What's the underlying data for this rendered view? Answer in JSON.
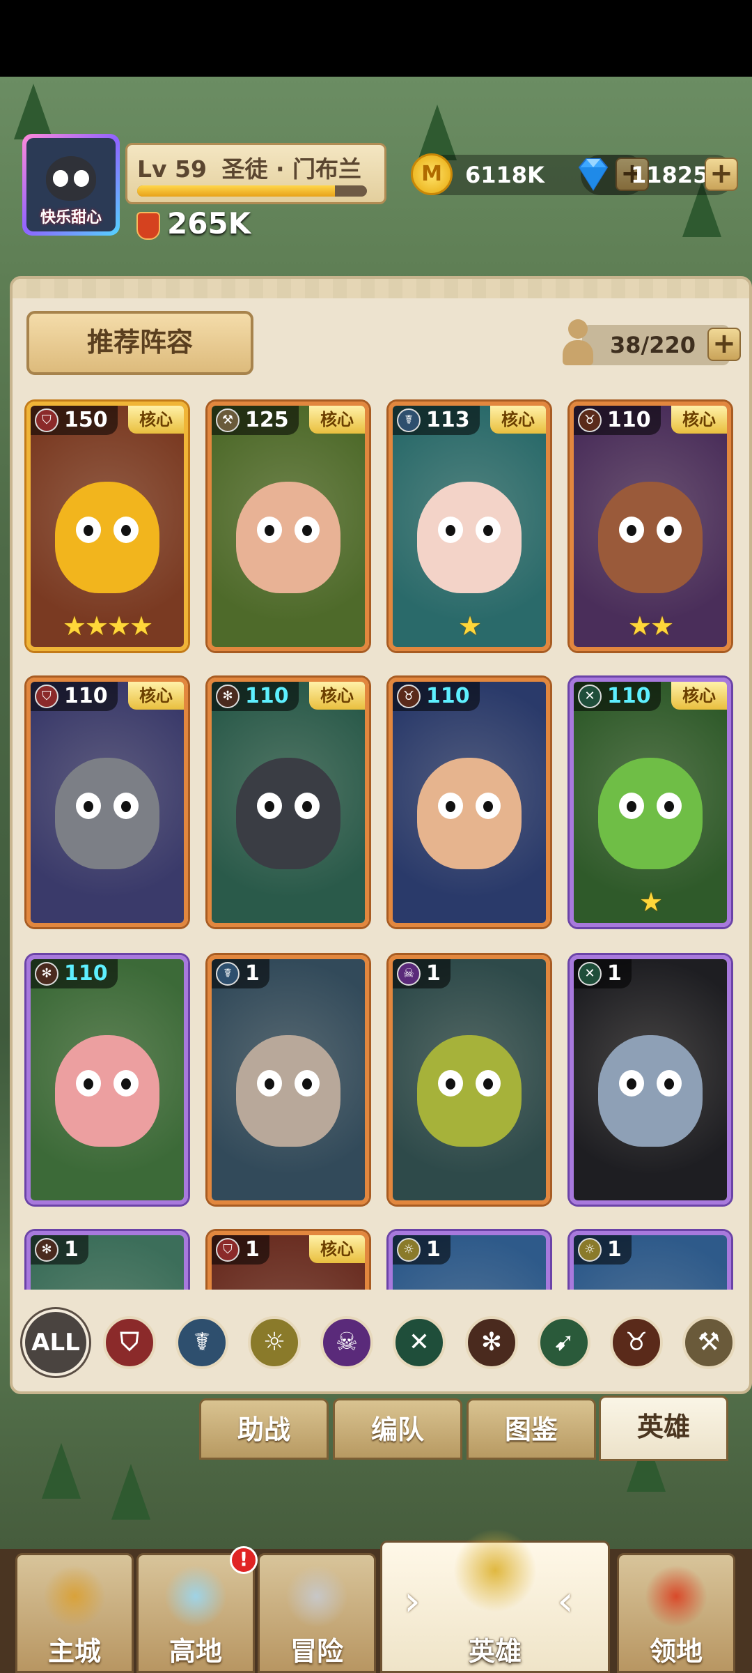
{
  "player": {
    "avatar_name": "快乐甜心",
    "level": "Lv 59",
    "title": "圣徒 · 门布兰",
    "xp_fraction": 0.86,
    "power": "265K"
  },
  "currency": {
    "gold": "6118K",
    "gold_symbol": "M",
    "gems": "11825",
    "add_symbol": "+"
  },
  "panel": {
    "recommend_label": "推荐阵容",
    "capacity": "38/220"
  },
  "heroes": [
    {
      "level": "150",
      "faction": "shield",
      "core": true,
      "stars": "★★★★",
      "rarity": "gold",
      "color": "#f2b51d",
      "bg": "#7a3a22"
    },
    {
      "level": "125",
      "faction": "hammer",
      "core": true,
      "stars": "",
      "rarity": "orange",
      "color": "#e8b295",
      "bg": "#4e6a2a"
    },
    {
      "level": "113",
      "faction": "water",
      "core": true,
      "stars": "★",
      "rarity": "orange",
      "color": "#f3d3c8",
      "bg": "#2a6a6a"
    },
    {
      "level": "110",
      "faction": "bull",
      "core": true,
      "stars": "★★",
      "rarity": "orange",
      "color": "#9a5a3a",
      "bg": "#4a2e5a"
    },
    {
      "level": "110",
      "faction": "shield",
      "core": true,
      "stars": "",
      "rarity": "orange",
      "color": "#7c7f86",
      "bg": "#3a3a6a"
    },
    {
      "level": "110",
      "faction": "paw",
      "core": true,
      "stars": "",
      "rarity": "orange",
      "color": "#3a3d44",
      "bg": "#2a5a4a",
      "teal": true
    },
    {
      "level": "110",
      "faction": "bull",
      "core": false,
      "stars": "",
      "rarity": "orange",
      "color": "#e6b48e",
      "bg": "#2a3a6a",
      "teal": true
    },
    {
      "level": "110",
      "faction": "sword",
      "core": true,
      "stars": "★",
      "rarity": "purple",
      "color": "#6fbe46",
      "bg": "#2f5a2a",
      "teal": true
    },
    {
      "level": "110",
      "faction": "paw",
      "core": false,
      "stars": "",
      "rarity": "purple",
      "color": "#ec9fa0",
      "bg": "#3c6a38",
      "teal": true
    },
    {
      "level": "1",
      "faction": "water",
      "core": false,
      "stars": "",
      "rarity": "orange",
      "color": "#b8a89a",
      "bg": "#324a5a"
    },
    {
      "level": "1",
      "faction": "skull",
      "core": false,
      "stars": "",
      "rarity": "orange",
      "color": "#a6b23a",
      "bg": "#2e4a4a"
    },
    {
      "level": "1",
      "faction": "sword",
      "core": false,
      "stars": "",
      "rarity": "purple",
      "color": "#8ea0b6",
      "bg": "#1e1e22"
    },
    {
      "level": "1",
      "faction": "paw",
      "core": false,
      "stars": "",
      "rarity": "purple",
      "color": "#7fb86a",
      "bg": "#3c6e5a"
    },
    {
      "level": "1",
      "faction": "shield",
      "core": true,
      "stars": "",
      "rarity": "orange",
      "color": "#b27a4a",
      "bg": "#6a2e22"
    },
    {
      "level": "1",
      "faction": "sun",
      "core": false,
      "stars": "",
      "rarity": "purple",
      "color": "#5a8ab0",
      "bg": "#2e5a8a"
    },
    {
      "level": "1",
      "faction": "sun",
      "core": false,
      "stars": "",
      "rarity": "purple",
      "color": "#5a8ab0",
      "bg": "#2e5a8a"
    }
  ],
  "core_label": "核心",
  "filters": [
    {
      "label": "ALL",
      "icon": "all-icon",
      "color": "#4a4440",
      "glyph": "ALL"
    },
    {
      "label": "",
      "icon": "shield-faction-icon",
      "color": "#8b2a2a",
      "glyph": "⛉"
    },
    {
      "label": "",
      "icon": "water-faction-icon",
      "color": "#2e4f6e",
      "glyph": "☤"
    },
    {
      "label": "",
      "icon": "sun-faction-icon",
      "color": "#8a7a2a",
      "glyph": "☼"
    },
    {
      "label": "",
      "icon": "skull-faction-icon",
      "color": "#5a2a7a",
      "glyph": "☠"
    },
    {
      "label": "",
      "icon": "swords-faction-icon",
      "color": "#1f4e3a",
      "glyph": "✕"
    },
    {
      "label": "",
      "icon": "paw-faction-icon",
      "color": "#4a2a1e",
      "glyph": "✻"
    },
    {
      "label": "",
      "icon": "bow-faction-icon",
      "color": "#2a5a3a",
      "glyph": "➹"
    },
    {
      "label": "",
      "icon": "bull-faction-icon",
      "color": "#5a2a1a",
      "glyph": "♉"
    },
    {
      "label": "",
      "icon": "hammer-faction-icon",
      "color": "#6a5a3a",
      "glyph": "⚒"
    }
  ],
  "tabs": [
    {
      "label": "助战",
      "active": false
    },
    {
      "label": "编队",
      "active": false
    },
    {
      "label": "图鉴",
      "active": false
    },
    {
      "label": "英雄",
      "active": true
    }
  ],
  "nav": [
    {
      "label": "主城",
      "icon": "castle-icon"
    },
    {
      "label": "高地",
      "icon": "highland-icon",
      "alert": "!"
    },
    {
      "label": "冒险",
      "icon": "crossed-swords-icon"
    },
    {
      "label": "英雄",
      "icon": "hero-helmet-icon",
      "active": true
    },
    {
      "label": "领地",
      "icon": "territory-banner-icon"
    }
  ]
}
